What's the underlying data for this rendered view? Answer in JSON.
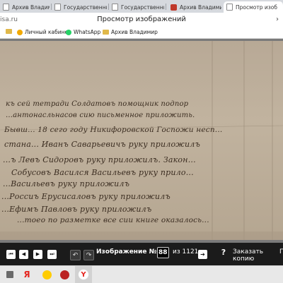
{
  "browser": {
    "tabs": [
      {
        "label": "Архив Владимир",
        "active": false
      },
      {
        "label": "Государственный",
        "active": false
      },
      {
        "label": "Государственный",
        "active": false
      },
      {
        "label": "Архив Владимир",
        "active": false
      },
      {
        "label": "Просмотр изоб",
        "active": true
      }
    ],
    "address_fragment": "isa.ru",
    "page_title": "Просмотр изображений",
    "bookmarks": [
      {
        "label": "",
        "icon": "folder-icon"
      },
      {
        "label": "Личный кабинет",
        "icon": "lk-icon"
      },
      {
        "label": "WhatsApp",
        "icon": "whatsapp-icon"
      },
      {
        "label": "Архив Владимир",
        "icon": "folder-icon"
      }
    ]
  },
  "document": {
    "lines": [
      "къ сей тетради Солдатовъ помощник подпор",
      "...антонасльнасов сию письменное приложить.",
      "Бывш... 18 сего году Никифоровской Госпожи несп...",
      "стана... Иванъ Саварьевичъ руку приложилъ",
      "...ъ Левъ Сидоровъ руку приложилъ. Закон...",
      "Собусовъ Васился Васильевъ руку прило...",
      "...Васильевъ руку приложилъ",
      "...Россиъ Ерусисаловъ руку приложилъ",
      "...Ефимъ Павловъ руку приложилъ",
      "...тоео по разметке все сии книге оказалось..."
    ]
  },
  "viewer": {
    "image_label": "Изображение №:",
    "image_number": "88",
    "of_text": "из 1121",
    "order_copy": "Заказать копию",
    "order_more": "П"
  },
  "taskbar": {
    "apps": [
      "Я",
      "Yandex Browser"
    ]
  },
  "colors": {
    "control_bar": "#1b1b1b",
    "paper": "#bdae99",
    "ink": "#3a2c20",
    "active_tab": "#ffffff"
  }
}
